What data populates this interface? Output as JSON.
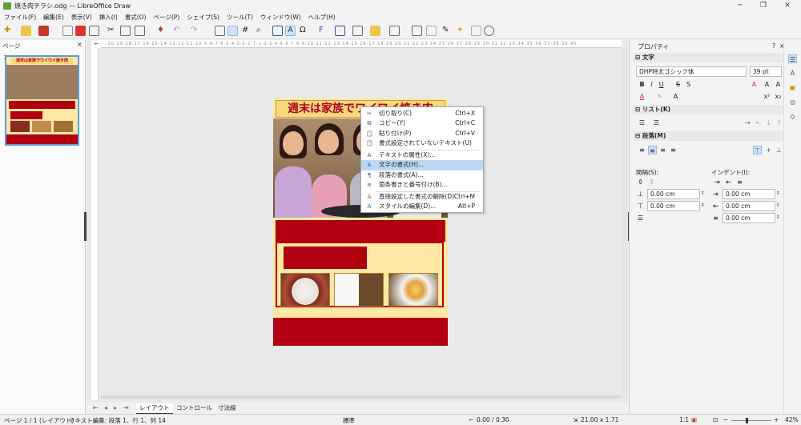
{
  "window": {
    "title": "焼き肉チラシ.odg — LibreOffice Draw",
    "minimize": "─",
    "maximize": "❐",
    "close": "✕"
  },
  "menu": [
    "ファイル(F)",
    "編集(E)",
    "表示(V)",
    "挿入(I)",
    "書式(O)",
    "ページ(P)",
    "シェイプ(S)",
    "ツール(T)",
    "ウィンドウ(W)",
    "ヘルプ(H)"
  ],
  "pages_pane": {
    "title": "ページ",
    "close": "×",
    "thumb_title": "週末は家族でワイワイ焼き肉"
  },
  "ruler": {
    "h": "·20·19·18·17·16·15·14·13·12·11·10·9·8·7·6·5·4·3·2·1·│·1·2·3·4·5·6·7·8·9·10·11·12·13·14·15·16·17·18·19·20·21·22·23·24·25·26·27·28·29·30·31·32·33·34·35·36·37·38·39·40"
  },
  "flyer": {
    "title": "週末は家族でワイワイ焼き肉"
  },
  "context_menu": [
    {
      "icon": "✂",
      "label": "切り取り(C)",
      "shortcut": "Ctrl+X"
    },
    {
      "icon": "⧉",
      "label": "コピー(Y)",
      "shortcut": "Ctrl+C"
    },
    {
      "icon": "📋",
      "label": "貼り付け(P)",
      "shortcut": "Ctrl+V"
    },
    {
      "icon": "📋",
      "label": "書式設定されていないテキスト(U)",
      "shortcut": ""
    },
    {
      "icon": "A",
      "label": "テキストの属性(X)...",
      "shortcut": ""
    },
    {
      "icon": "A",
      "label": "文字の書式(H)...",
      "shortcut": ""
    },
    {
      "icon": "¶",
      "label": "段落の書式(A)...",
      "shortcut": ""
    },
    {
      "icon": "≡",
      "label": "箇条書きと番号付け(B)...",
      "shortcut": ""
    },
    {
      "icon": "A",
      "label": "直接設定した書式の解除(D)",
      "shortcut": "Ctrl+M"
    },
    {
      "icon": "A",
      "label": "スタイルの編集(D)...",
      "shortcut": "Alt+P"
    }
  ],
  "tabs": [
    "レイアウト",
    "コントロール",
    "寸法線"
  ],
  "sidebar": {
    "title": "プロパティ",
    "help": "?",
    "close": "×",
    "sec_char": "文字",
    "font_name": "DHP特太ゴシック体",
    "font_size": "39 pt",
    "sec_list": "リスト(K)",
    "sec_para": "段落(M)",
    "spacing_label": "間隔(S):",
    "indent_label": "インデント(I):",
    "spacing_above": "0.00 cm",
    "spacing_below": "0.00 cm",
    "indent_before": "0.00 cm",
    "indent_after": "0.00 cm",
    "indent_first": "0.00 cm"
  },
  "status": {
    "page": "ページ 1 / 1 (レイアウト)",
    "edit": "テキスト編集: 段落 1、行 1、列 14",
    "style": "標準",
    "position": "0.00 / 0.30",
    "size": "21.00 x 1.71",
    "scale": "1:1",
    "zoom": "42%"
  },
  "colors": {
    "accent": "#b00012",
    "flyer_bg": "#ffe8a3",
    "highlight": "#bcd9f4"
  }
}
